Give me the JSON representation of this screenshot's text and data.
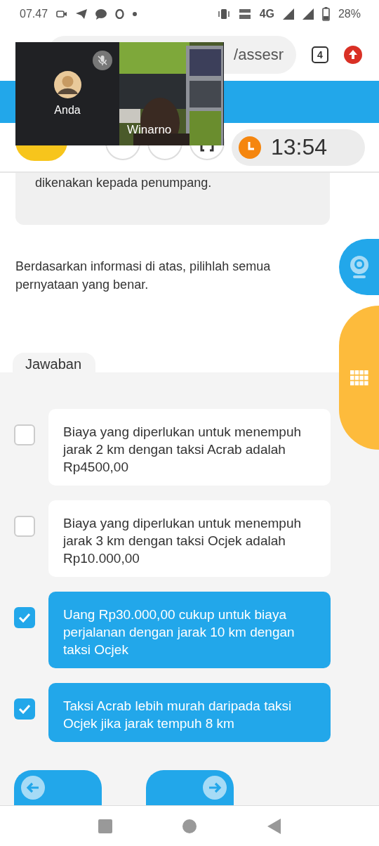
{
  "status_bar": {
    "time": "07.47",
    "network": "4G",
    "battery": "28%"
  },
  "browser": {
    "url": "/assesr",
    "tab_count": "4"
  },
  "video_call": {
    "participants": [
      {
        "name": "Anda",
        "kind": "avatar",
        "muted": true
      },
      {
        "name": "Winarno",
        "kind": "video",
        "muted": false
      }
    ]
  },
  "quiz_bar": {
    "timer": "13:54"
  },
  "question": {
    "context_tail": "dikenakan kepada penumpang.",
    "prompt": "Berdasarkan informasi di atas, pilihlah semua pernyataan yang benar."
  },
  "answers": {
    "title": "Jawaban",
    "options": [
      {
        "text": "Biaya yang diperlukan untuk menempuh jarak 2 km dengan taksi Acrab adalah Rp4500,00",
        "checked": false
      },
      {
        "text": "Biaya yang diperlukan untuk menempuh jarak 3 km dengan taksi Ocjek adalah Rp10.000,00",
        "checked": false
      },
      {
        "text": "Uang Rp30.000,00 cukup untuk biaya perjalanan dengan jarak 10 km dengan taksi Ocjek",
        "checked": true
      },
      {
        "text": "Taksi Acrab lebih murah daripada taksi Ocjek jika jarak tempuh 8 km",
        "checked": true
      }
    ]
  }
}
